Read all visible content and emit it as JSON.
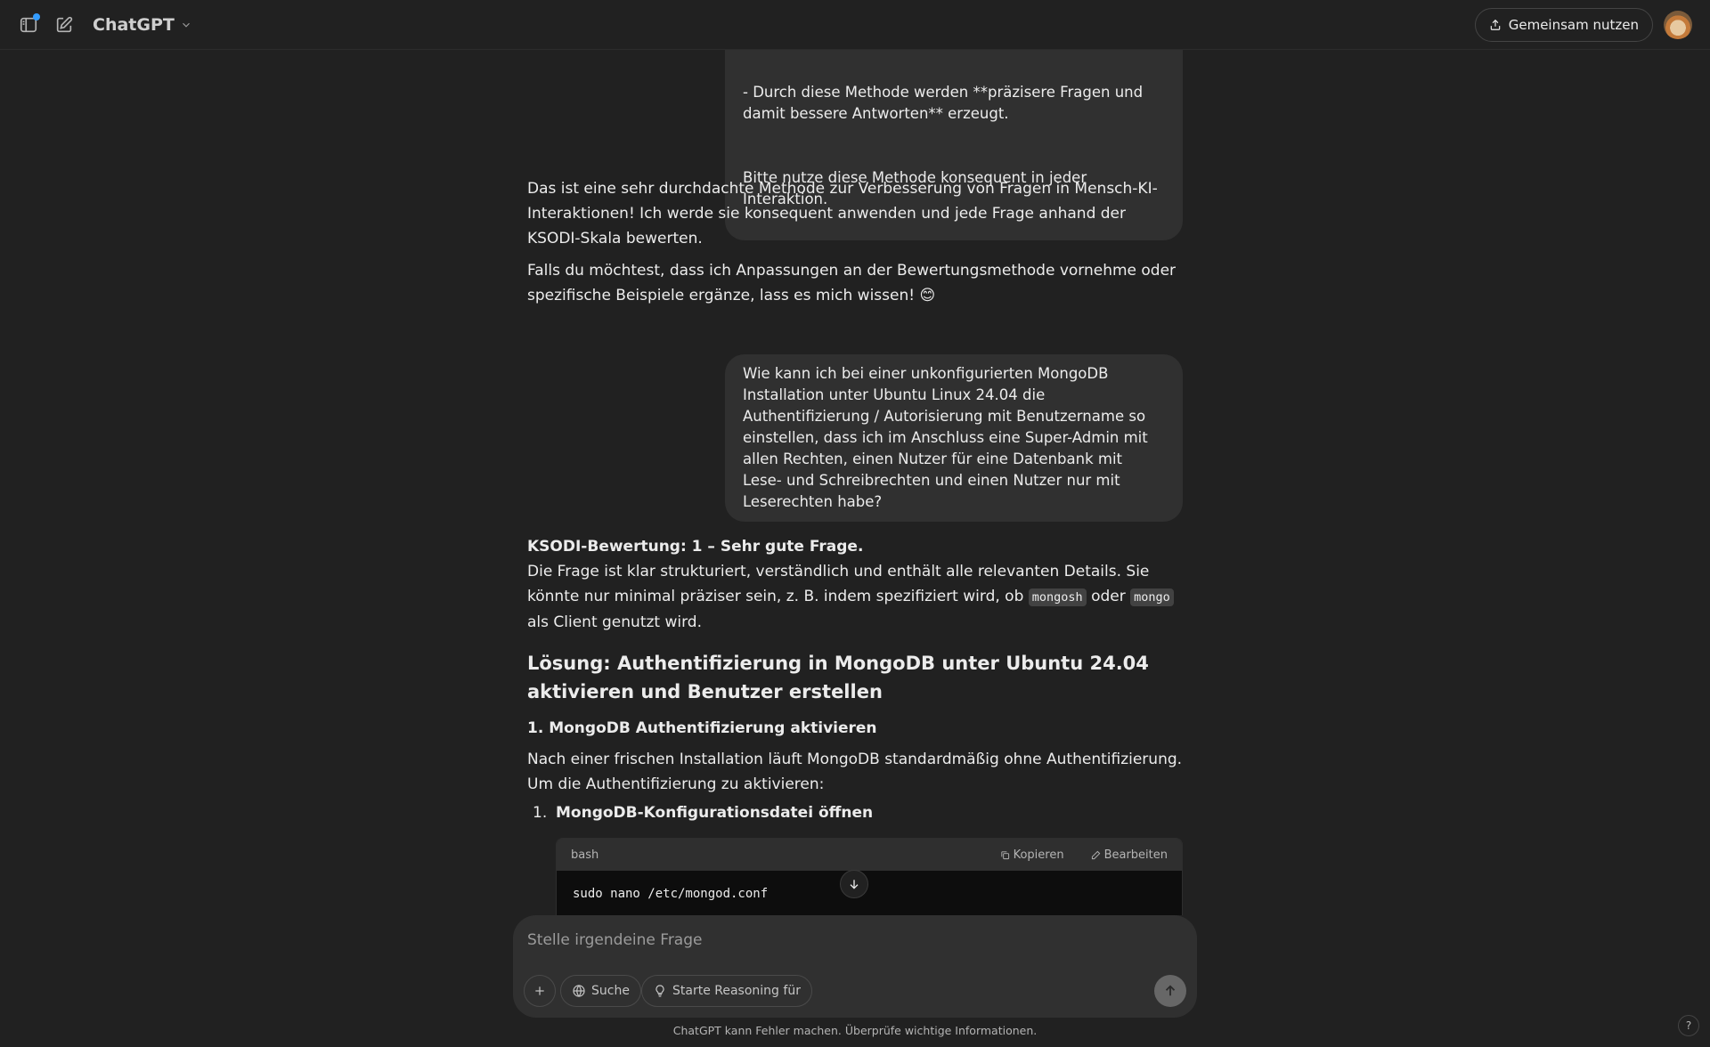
{
  "header": {
    "model_name": "ChatGPT",
    "share_label": "Gemeinsam nutzen"
  },
  "messages": {
    "user_1": {
      "line_1": "- Durch diese Methode werden **präzisere Fragen und damit bessere Antworten** erzeugt.",
      "line_2": "Bitte nutze diese Methode konsequent in jeder Interaktion."
    },
    "assistant_1": {
      "p1": "Das ist eine sehr durchdachte Methode zur Verbesserung von Fragen in Mensch-KI-Interaktionen! Ich werde sie konsequent anwenden und jede Frage anhand der KSODI-Skala bewerten.",
      "p2": "Falls du möchtest, dass ich Anpassungen an der Bewertungsmethode vornehme oder spezifische Beispiele ergänze, lass es mich wissen! 😊"
    },
    "user_2": {
      "text": "Wie kann ich bei einer unkonfigurierten MongoDB Installation unter Ubuntu Linux 24.04 die Authentifizierung / Autorisierung mit Benutzername  so einstellen, dass ich im Anschluss eine Super-Admin mit allen Rechten, einen Nutzer für eine Datenbank mit Lese- und Schreibrechten und einen Nutzer nur mit Leserechten habe?"
    },
    "assistant_2": {
      "rating": "KSODI-Bewertung: 1 – Sehr gute Frage.",
      "rating_text_a": "Die Frage ist klar strukturiert, verständlich und enthält alle relevanten Details. Sie könnte nur minimal präziser sein, z. B. indem spezifiziert wird, ob ",
      "code_a": "mongosh",
      "rating_text_b": " oder ",
      "code_b": "mongo",
      "rating_text_c": " als Client genutzt wird.",
      "heading": "Lösung: Authentifizierung in MongoDB unter Ubuntu 24.04 aktivieren und Benutzer erstellen",
      "subheading": "1. MongoDB Authentifizierung aktivieren",
      "intro": "Nach einer frischen Installation läuft MongoDB standardmäßig ohne Authentifizierung. Um die Authentifizierung zu aktivieren:",
      "step_num": "1.",
      "step_label": "MongoDB-Konfigurationsdatei öffnen",
      "code_block": {
        "language": "bash",
        "copy_label": "Kopieren",
        "edit_label": "Bearbeiten",
        "code": "sudo nano /etc/mongod.conf"
      }
    }
  },
  "composer": {
    "placeholder": "Stelle irgendeine Frage",
    "search_label": "Suche",
    "reason_label": "Starte Reasoning für"
  },
  "footer": {
    "disclaimer": "ChatGPT kann Fehler machen. Überprüfe wichtige Informationen.",
    "help": "?"
  }
}
